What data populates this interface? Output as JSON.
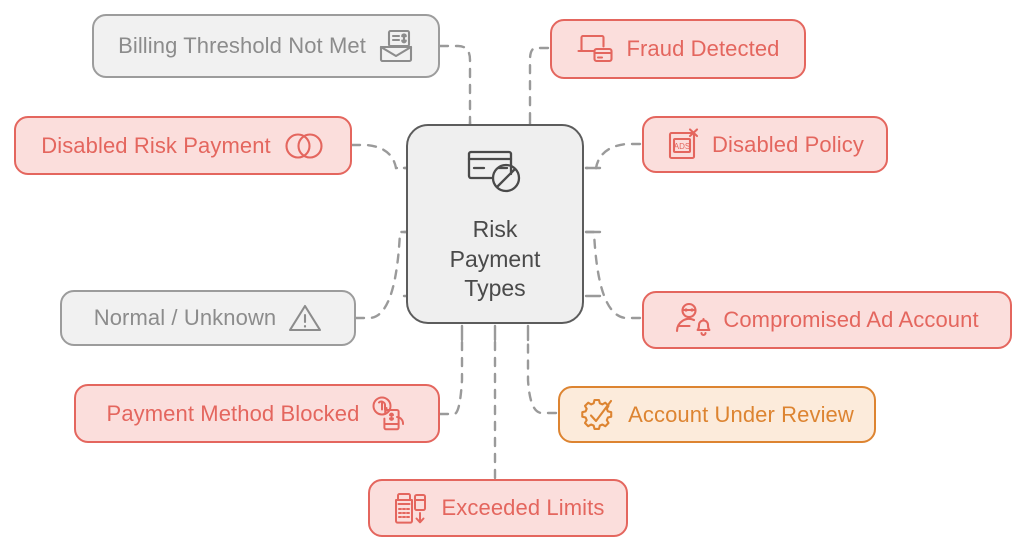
{
  "diagram": {
    "title": "Risk Payment Types",
    "type": "hub-and-spoke mind map",
    "colors": {
      "danger_fill": "#FBDEDC",
      "danger_stroke": "#E4665E",
      "neutral_fill": "#F1F1F1",
      "neutral_stroke": "#9C9C9C",
      "neutral_text": "#8C8C8C",
      "warn_fill": "#FCEBDB",
      "warn_stroke": "#DD8431",
      "hub_fill": "#EFEFEF",
      "hub_stroke": "#5C5C5C",
      "edge_stroke": "#9A9A9A",
      "background": "#FFFFFF"
    }
  },
  "hub": {
    "label_line1": "Risk",
    "label_line2": "Payment",
    "label_line3": "Types",
    "icon": "credit-card-blocked-icon"
  },
  "nodes": [
    {
      "id": "billing-threshold-not-met",
      "label": "Billing Threshold Not Met",
      "icon": "invoice-envelope-icon",
      "variant": "neutral",
      "icon_side": "right"
    },
    {
      "id": "fraud-detected",
      "label": "Fraud Detected",
      "icon": "laptop-card-fraud-icon",
      "variant": "danger",
      "icon_side": "left"
    },
    {
      "id": "disabled-risk-payment",
      "label": "Disabled Risk Payment",
      "icon": "overlapping-circles-icon",
      "variant": "danger",
      "icon_side": "right"
    },
    {
      "id": "disabled-policy",
      "label": "Disabled Policy",
      "icon": "ads-disabled-icon",
      "variant": "danger",
      "icon_side": "left"
    },
    {
      "id": "normal-unknown",
      "label": "Normal / Unknown",
      "icon": "warning-triangle-icon",
      "variant": "neutral",
      "icon_side": "right"
    },
    {
      "id": "compromised-ad-account",
      "label": "Compromised Ad Account",
      "icon": "hacker-alert-icon",
      "variant": "danger",
      "icon_side": "left"
    },
    {
      "id": "payment-method-blocked",
      "label": "Payment Method Blocked",
      "icon": "fingerprint-phone-pay-icon",
      "variant": "danger",
      "icon_side": "right"
    },
    {
      "id": "account-under-review",
      "label": "Account Under Review",
      "icon": "gear-check-icon",
      "variant": "warn",
      "icon_side": "left"
    },
    {
      "id": "exceeded-limits",
      "label": "Exceeded Limits",
      "icon": "pos-terminal-down-icon",
      "variant": "danger",
      "icon_side": "left"
    }
  ]
}
